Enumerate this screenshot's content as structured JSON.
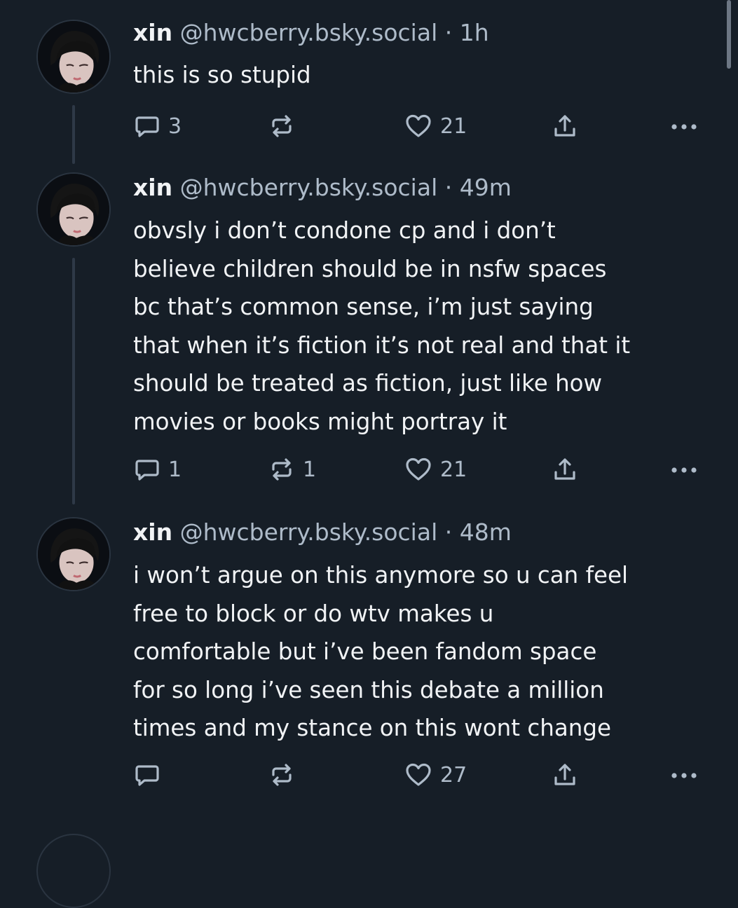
{
  "theme": {
    "background": "#161e27",
    "text": "#f1f3f5",
    "muted": "#aebbc9",
    "thread_line": "#2e3947"
  },
  "posts": [
    {
      "author_name": "xin",
      "handle": "@hwcberry.bsky.social",
      "separator": "·",
      "time": "1h",
      "avatar": "avatar-photo",
      "lines": [
        "this is so stupid"
      ],
      "actions": {
        "reply_icon": "speech-bubble-icon",
        "reply_count": "3",
        "repost_icon": "repost-arrows-icon",
        "repost_count": "",
        "like_icon": "heart-icon",
        "like_count": "21",
        "share_icon": "share-upload-icon",
        "more_icon": "ellipsis-icon"
      }
    },
    {
      "author_name": "xin",
      "handle": "@hwcberry.bsky.social",
      "separator": "·",
      "time": "49m",
      "avatar": "avatar-photo",
      "lines": [
        "obvsly i don’t condone cp and i don’t",
        "believe children should be in nsfw spaces",
        "bc that’s common sense, i’m just saying",
        "that when it’s fiction it’s not real and that it",
        "should be treated as fiction, just like how",
        "movies or books might portray it"
      ],
      "actions": {
        "reply_icon": "speech-bubble-icon",
        "reply_count": "1",
        "repost_icon": "repost-arrows-icon",
        "repost_count": "1",
        "like_icon": "heart-icon",
        "like_count": "21",
        "share_icon": "share-upload-icon",
        "more_icon": "ellipsis-icon"
      }
    },
    {
      "author_name": "xin",
      "handle": "@hwcberry.bsky.social",
      "separator": "·",
      "time": "48m",
      "avatar": "avatar-photo",
      "lines": [
        "i won’t argue on this anymore so u can feel",
        "free to block or do wtv makes u",
        "comfortable but i’ve been fandom space",
        "for so long i’ve seen this debate a million",
        "times and my stance on this wont change"
      ],
      "actions": {
        "reply_icon": "speech-bubble-icon",
        "reply_count": "",
        "repost_icon": "repost-arrows-icon",
        "repost_count": "",
        "like_icon": "heart-icon",
        "like_count": "27",
        "share_icon": "share-upload-icon",
        "more_icon": "ellipsis-icon"
      }
    }
  ]
}
